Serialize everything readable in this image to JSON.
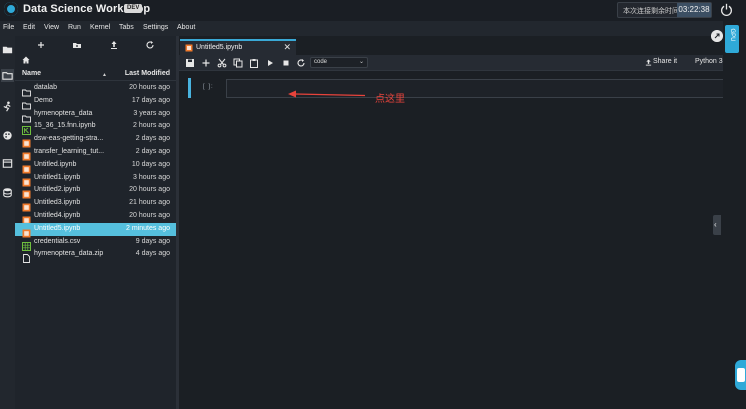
{
  "header": {
    "app_title": "Data Science Workshop",
    "env_badge": "DEV",
    "remaining_label": "本次连接剩余时间",
    "remaining_time": "03:22:38"
  },
  "menu": [
    "File",
    "Edit",
    "View",
    "Run",
    "Kernel",
    "Tabs",
    "Settings",
    "About"
  ],
  "filebrowser": {
    "col_name": "Name",
    "col_modified": "Last Modified",
    "files": [
      {
        "name": "datalab",
        "modified": "20 hours ago",
        "type": "folder"
      },
      {
        "name": "Demo",
        "modified": "17 days ago",
        "type": "folder"
      },
      {
        "name": "hymenoptera_data",
        "modified": "3 years ago",
        "type": "folder"
      },
      {
        "name": "15_36_15.fnn.ipynb",
        "modified": "2 hours ago",
        "type": "notebook-green"
      },
      {
        "name": "dsw-eas-getting-stra...",
        "modified": "2 days ago",
        "type": "notebook"
      },
      {
        "name": "transfer_learning_tut...",
        "modified": "2 days ago",
        "type": "notebook"
      },
      {
        "name": "Untitled.ipynb",
        "modified": "10 days ago",
        "type": "notebook"
      },
      {
        "name": "Untitled1.ipynb",
        "modified": "3 hours ago",
        "type": "notebook"
      },
      {
        "name": "Untitled2.ipynb",
        "modified": "20 hours ago",
        "type": "notebook"
      },
      {
        "name": "Untitled3.ipynb",
        "modified": "21 hours ago",
        "type": "notebook"
      },
      {
        "name": "Untitled4.ipynb",
        "modified": "20 hours ago",
        "type": "notebook"
      },
      {
        "name": "Untitled5.ipynb",
        "modified": "2 minutes ago",
        "type": "notebook",
        "selected": true
      },
      {
        "name": "credentials.csv",
        "modified": "9 days ago",
        "type": "csv"
      },
      {
        "name": "hymenoptera_data.zip",
        "modified": "4 days ago",
        "type": "file"
      }
    ]
  },
  "editor": {
    "tab_label": "Untitled5.ipynb",
    "tab_close": "✕",
    "cell_type": "code",
    "share_label": "Share it",
    "kernel_label": "Python 3",
    "cell_prompt": "[ ]:",
    "annotation": "点这里"
  },
  "side": {
    "gpu_label": "GPU"
  },
  "colors": {
    "accent": "#2fa9d8",
    "selected_row": "#55bfdd",
    "annotation_red": "#e8433b",
    "notebook_orange": "#f07a2b",
    "csv_green": "#6fbf3e"
  }
}
